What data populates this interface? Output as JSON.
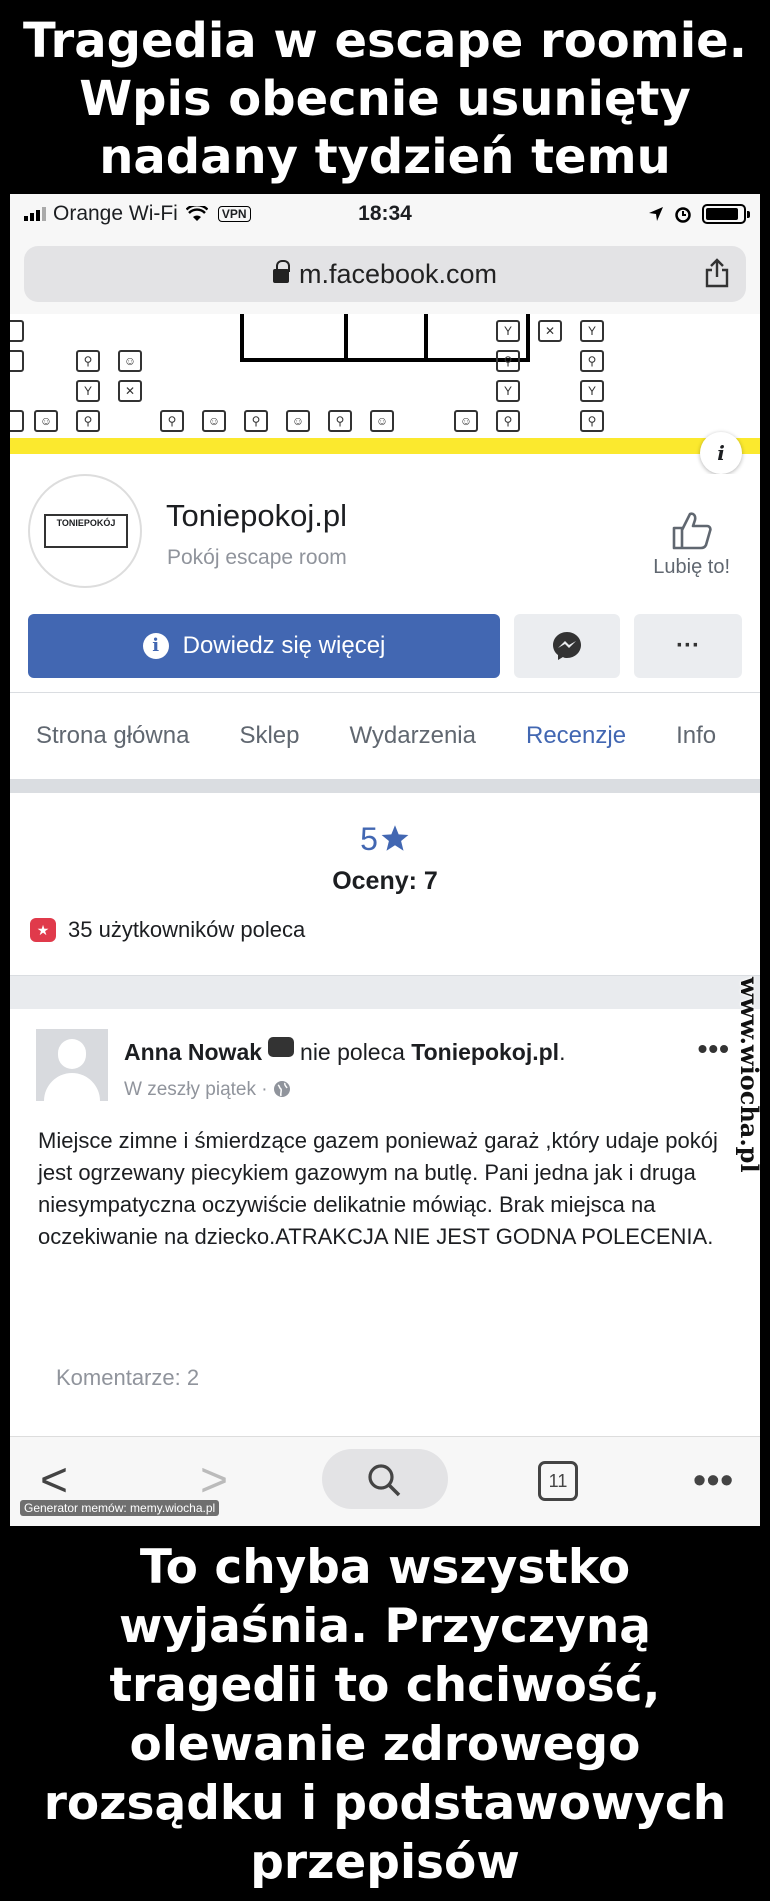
{
  "meme": {
    "top_caption": "Tragedia w escape roomie. Wpis obecnie usunięty nadany tydzień temu",
    "bottom_caption": "To chyba wszystko wyjaśnia. Przyczyną tragedii to chciwość, olewanie zdrowego rozsądku i podstawowych przepisów",
    "watermark": "www.wiocha.pl",
    "generator": "Generator memów: memy.wiocha.pl"
  },
  "status_bar": {
    "carrier": "Orange Wi-Fi",
    "vpn": "VPN",
    "time": "18:34",
    "battery_level": 0.9
  },
  "browser": {
    "url": "m.facebook.com"
  },
  "page": {
    "name": "Toniepokoj.pl",
    "category": "Pokój escape room",
    "logo_text": "TONIEPOKÓJ",
    "like_label": "Lubię to!",
    "learn_more_label": "Dowiedz się więcej",
    "more_label": "···"
  },
  "tabs": [
    {
      "label": "Strona główna"
    },
    {
      "label": "Sklep"
    },
    {
      "label": "Wydarzenia"
    },
    {
      "label": "Recenzje",
      "active": true
    },
    {
      "label": "Info"
    }
  ],
  "rating": {
    "score": "5",
    "count_label": "Oceny: 7",
    "recommend_label": "35 użytkowników poleca"
  },
  "review": {
    "author": "Anna Nowak",
    "verb": "nie poleca",
    "target": "Toniepokoj.pl",
    "time": "W zeszły piątek · ",
    "text": "Miejsce zimne i śmierdzące gazem ponieważ garaż ,który udaje pokój jest ogrzewany piecykiem gazowym na butlę. Pani jedna jak i druga niesympatyczna oczywiście delikatnie mówiąc. Brak miejsca na oczekiwanie na dziecko.ATRAKCJA NIE JEST GODNA POLECENIA.",
    "comments_label": "Komentarze: 2"
  },
  "bottom_bar": {
    "tab_count": "11"
  },
  "colors": {
    "facebook_blue": "#4267b2",
    "cover_yellow": "#fbe92e",
    "recommend_red": "#e03a4b"
  }
}
